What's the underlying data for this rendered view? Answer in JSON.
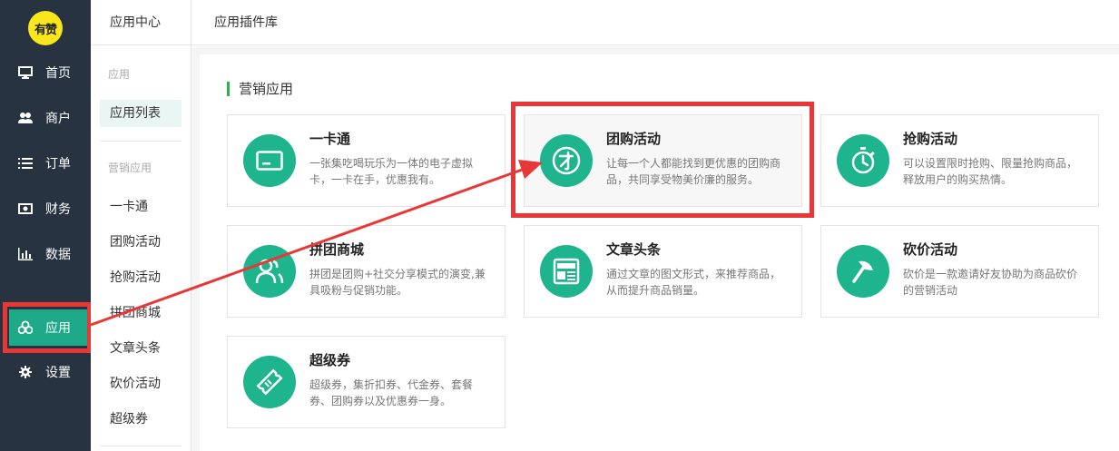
{
  "logo": {
    "text": "有赞"
  },
  "nav": {
    "items": [
      {
        "label": "首页",
        "icon": "monitor-icon"
      },
      {
        "label": "商户",
        "icon": "users-icon"
      },
      {
        "label": "订单",
        "icon": "list-icon"
      },
      {
        "label": "财务",
        "icon": "money-icon"
      },
      {
        "label": "数据",
        "icon": "bar-chart-icon"
      },
      {
        "label": "应用",
        "icon": "apps-icon",
        "active": true
      },
      {
        "label": "设置",
        "icon": "gear-icon"
      }
    ]
  },
  "sub_sidebar": {
    "title": "应用中心",
    "group1": "应用",
    "app_list": "应用列表",
    "group2": "营销应用",
    "items": [
      "一卡通",
      "团购活动",
      "抢购活动",
      "拼团商城",
      "文章头条",
      "砍价活动",
      "超级券"
    ]
  },
  "header": {
    "title": "应用插件库"
  },
  "section": {
    "title": "营销应用"
  },
  "cards": [
    {
      "title": "一卡通",
      "desc": "一张集吃喝玩乐为一体的电子虚拟卡，一卡在手，优惠我有。",
      "icon": "card-icon"
    },
    {
      "title": "团购活动",
      "desc": "让每一个人都能找到更优惠的团购商品，共同享受物美价廉的服务。",
      "icon": "group-buy-icon"
    },
    {
      "title": "抢购活动",
      "desc": "可以设置限时抢购、限量抢购商品，释放用户的购买热情。",
      "icon": "stopwatch-icon"
    },
    {
      "title": "拼团商城",
      "desc": "拼团是团购+社交分享模式的演变,兼具吸粉与促销功能。",
      "icon": "team-icon"
    },
    {
      "title": "文章头条",
      "desc": "通过文章的图文形式，来推荐商品，从而提升商品销量。",
      "icon": "news-icon"
    },
    {
      "title": "砍价活动",
      "desc": "砍价是一款邀请好友协助为商品砍价的营销活动",
      "icon": "axe-icon"
    },
    {
      "title": "超级券",
      "desc": "超级券，集折扣券、代金券、套餐券、团购券以及优惠券一身。",
      "icon": "ticket-icon"
    }
  ],
  "colors": {
    "sidebar": "#273340",
    "accent": "#1eaa89",
    "icon_bg": "#1db48e",
    "highlight": "#e93636",
    "logo": "#f9e71b"
  }
}
